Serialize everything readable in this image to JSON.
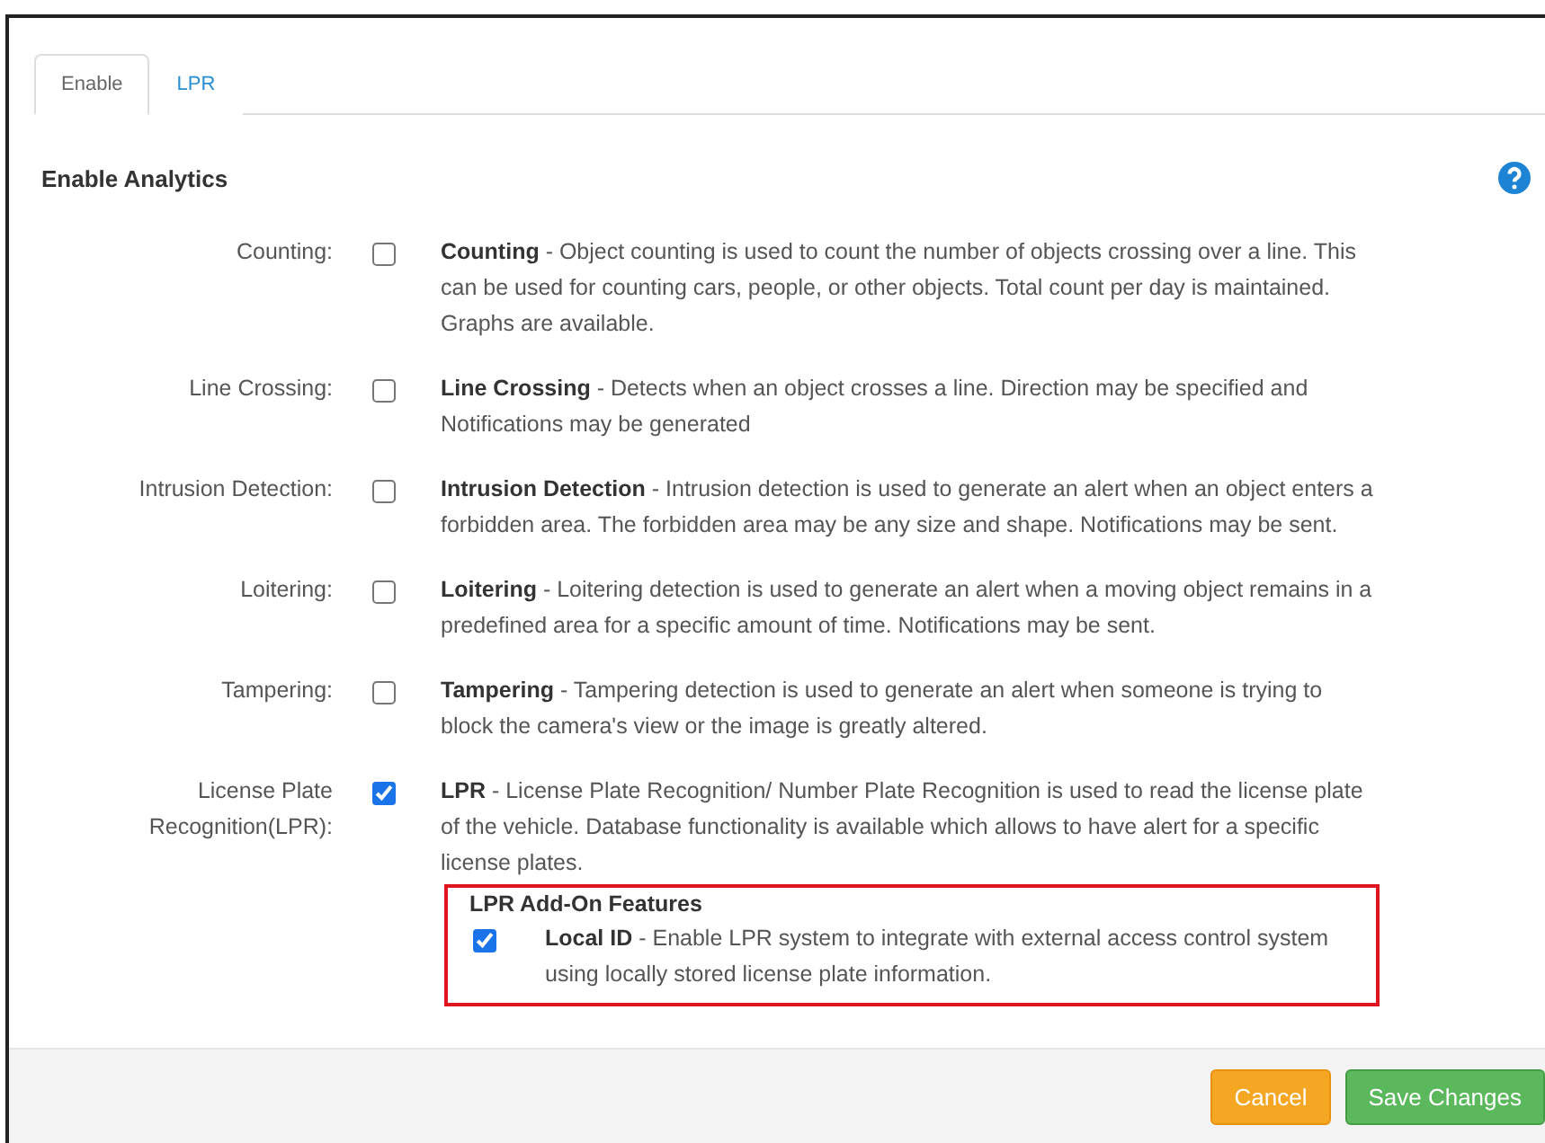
{
  "tabs": [
    {
      "label": "Enable",
      "selected": true
    },
    {
      "label": "LPR",
      "selected": false
    }
  ],
  "heading": "Enable Analytics",
  "analytics": [
    {
      "label": "Counting:",
      "checked": false,
      "name": "Counting",
      "description": " - Object counting is used to count the number of objects crossing over a line. This can be used for counting cars, people, or other objects. Total count per day is maintained. Graphs are available."
    },
    {
      "label": "Line Crossing:",
      "checked": false,
      "name": "Line Crossing",
      "description": " - Detects when an object crosses a line. Direction may be specified and Notifications may be generated"
    },
    {
      "label": "Intrusion Detection:",
      "checked": false,
      "name": "Intrusion Detection",
      "description": " - Intrusion detection is used to generate an alert when an object enters a forbidden area. The forbidden area may be any size and shape. Notifications may be sent."
    },
    {
      "label": "Loitering:",
      "checked": false,
      "name": "Loitering",
      "description": " - Loitering detection is used to generate an alert when a moving object remains in a predefined area for a specific amount of time. Notifications may be sent."
    },
    {
      "label": "Tampering:",
      "checked": false,
      "name": "Tampering",
      "description": " - Tampering detection is used to generate an alert when someone is trying to block the camera's view or the image is greatly altered."
    },
    {
      "label": "License Plate Recognition(LPR):",
      "checked": true,
      "name": "LPR",
      "description": " - License Plate Recognition/ Number Plate Recognition is used to read the license plate of the vehicle. Database functionality is available which allows to have alert for a specific license plates."
    }
  ],
  "addon": {
    "title": "LPR Add-On Features",
    "features": [
      {
        "checked": true,
        "name": "Local ID",
        "description": " - Enable LPR system to integrate with external access control system using locally stored license plate information."
      }
    ]
  },
  "buttons": [
    {
      "label": "Cancel",
      "kind": "cancel"
    },
    {
      "label": "Save Changes",
      "kind": "save"
    }
  ]
}
